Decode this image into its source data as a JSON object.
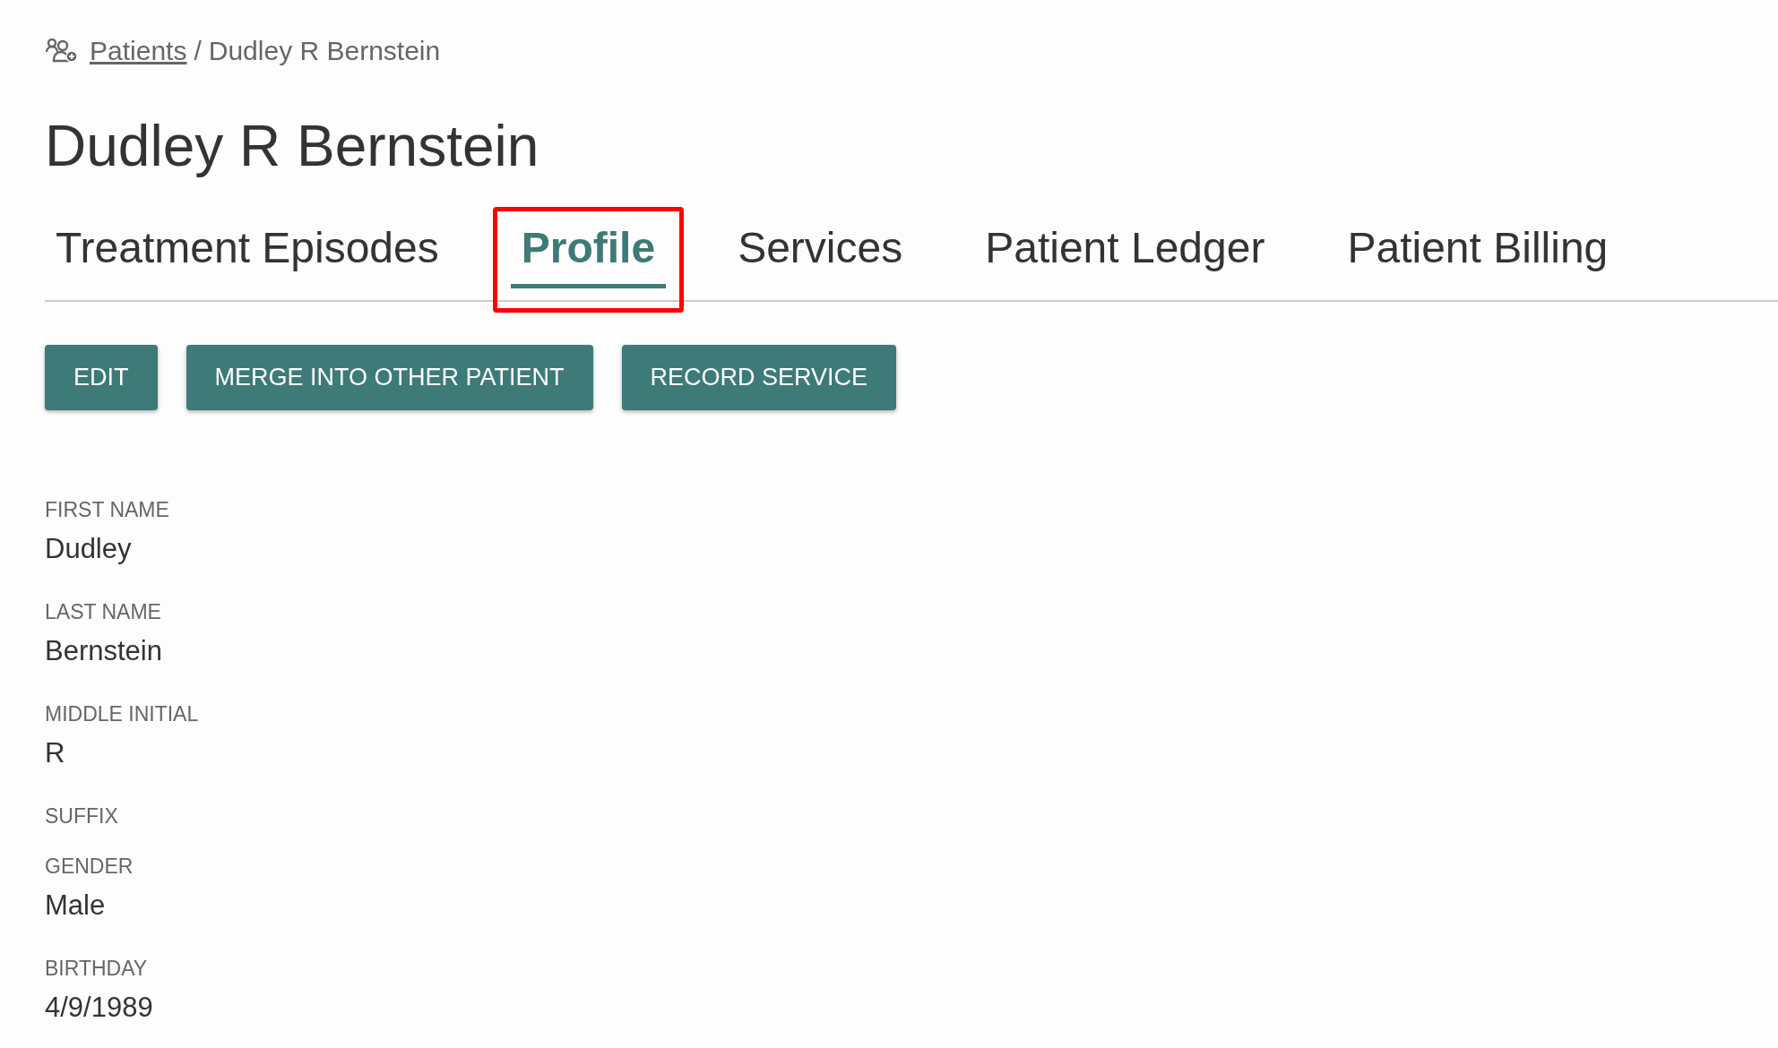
{
  "breadcrumb": {
    "link": "Patients",
    "separator": "/",
    "current": "Dudley R Bernstein"
  },
  "title": "Dudley R Bernstein",
  "tabs": [
    {
      "label": "Treatment Episodes",
      "selected": false,
      "outlined": false
    },
    {
      "label": "Profile",
      "selected": true,
      "outlined": true
    },
    {
      "label": "Services",
      "selected": false,
      "outlined": false
    },
    {
      "label": "Patient Ledger",
      "selected": false,
      "outlined": false
    },
    {
      "label": "Patient Billing",
      "selected": false,
      "outlined": false
    }
  ],
  "buttons": [
    "EDIT",
    "MERGE INTO OTHER PATIENT",
    "RECORD SERVICE"
  ],
  "fields": [
    {
      "label": "FIRST NAME",
      "value": "Dudley"
    },
    {
      "label": "LAST NAME",
      "value": "Bernstein"
    },
    {
      "label": "MIDDLE INITIAL",
      "value": "R"
    },
    {
      "label": "SUFFIX"
    },
    {
      "label": "GENDER",
      "value": "Male"
    },
    {
      "label": "BIRTHDAY",
      "value": "4/9/1989"
    }
  ]
}
